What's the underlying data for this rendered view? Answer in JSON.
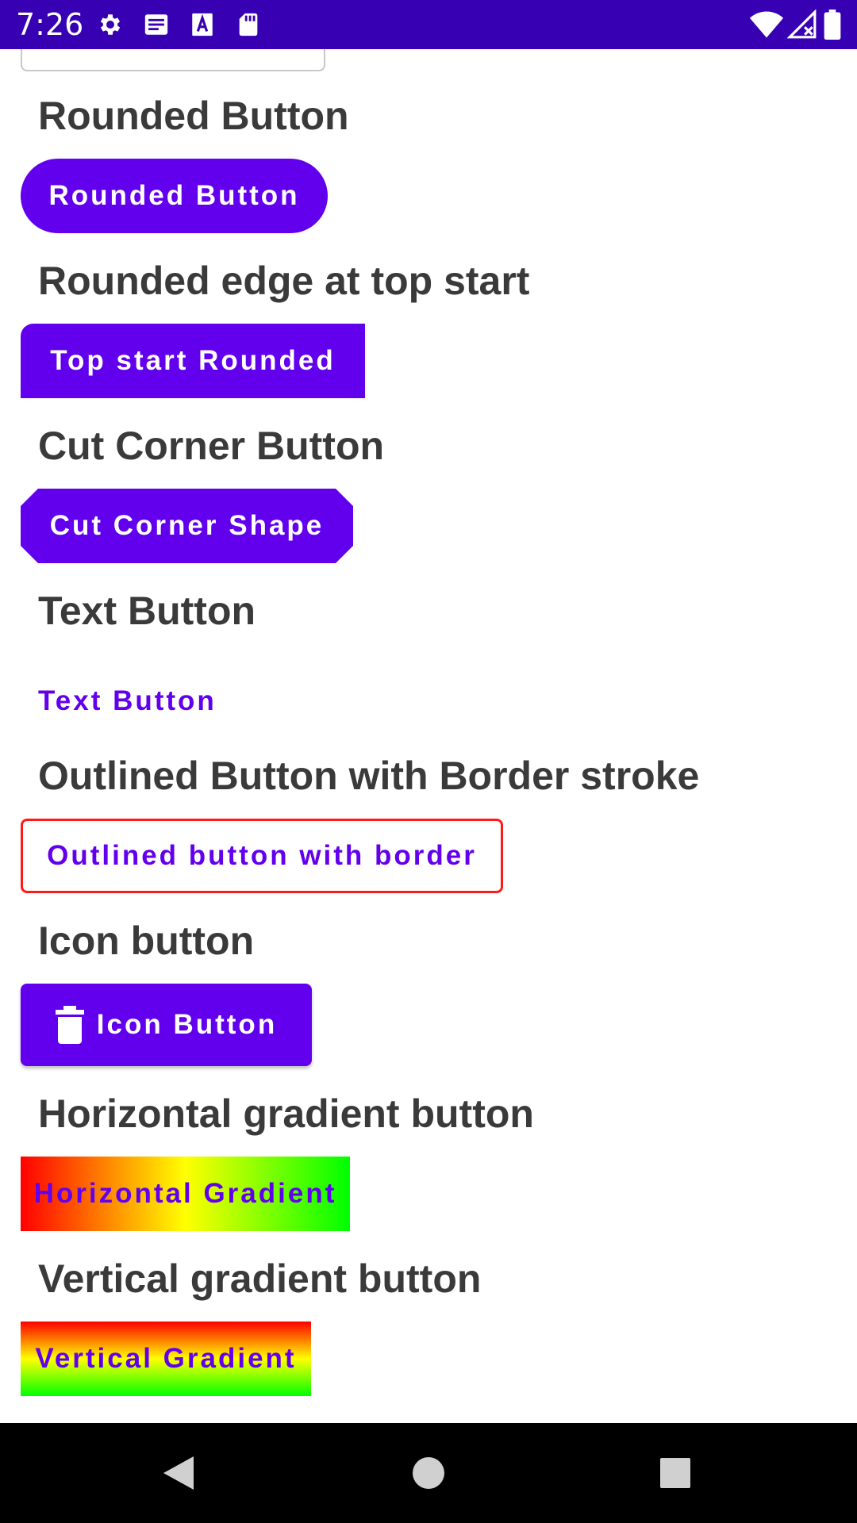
{
  "status_bar": {
    "time": "7:26",
    "left_icons": [
      "gear-icon",
      "message-icon",
      "font-a-icon",
      "sd-card-icon"
    ],
    "right_icons": [
      "wifi-icon",
      "no-signal-icon",
      "battery-icon"
    ],
    "background": "#3700B3"
  },
  "sections": {
    "rounded": {
      "heading": "Rounded Button",
      "button": "Rounded Button"
    },
    "topstart": {
      "heading": "Rounded edge at top start",
      "button": "Top start Rounded"
    },
    "cut": {
      "heading": "Cut Corner Button",
      "button": "Cut Corner Shape"
    },
    "text": {
      "heading": "Text Button",
      "button": "Text Button"
    },
    "outlined": {
      "heading": "Outlined Button with Border stroke",
      "button": "Outlined button with border"
    },
    "icon": {
      "heading": "Icon button",
      "button": "Icon Button",
      "icon": "trash-icon"
    },
    "hgrad": {
      "heading": "Horizontal gradient button",
      "button": "Horizontal Gradient"
    },
    "vgrad": {
      "heading": "Vertical gradient button",
      "button": "Vertical Gradient"
    }
  },
  "colors": {
    "primary": "#6200EE",
    "outline_border": "#FF0000",
    "gradient": [
      "#FF0000",
      "#FFFF00",
      "#00FF00"
    ]
  },
  "nav_bar": {
    "items": [
      "back-icon",
      "home-icon",
      "recents-icon"
    ]
  }
}
